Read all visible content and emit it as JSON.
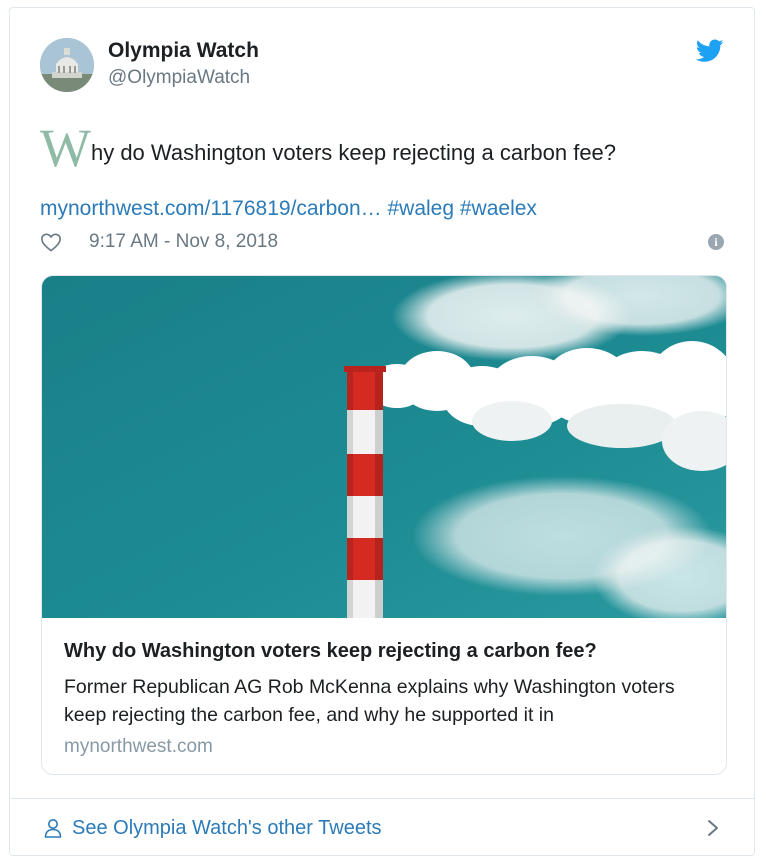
{
  "author": {
    "name": "Olympia Watch",
    "handle": "@OlympiaWatch"
  },
  "tweet": {
    "dropcap": "W",
    "text_rest": "hy do Washington voters keep rejecting a carbon fee?",
    "link": "mynorthwest.com/1176819/carbon…",
    "hashtags": [
      "#waleg",
      "#waelex"
    ],
    "timestamp": "9:17 AM - Nov 8, 2018"
  },
  "card": {
    "title": "Why do Washington voters keep rejecting a carbon fee?",
    "description": "Former Republican AG Rob McKenna explains why Washington voters keep rejecting the carbon fee, and why he supported it in",
    "domain": "mynorthwest.com"
  },
  "footer": {
    "label": "See Olympia Watch's other Tweets"
  },
  "icons": {
    "brand": "twitter-bird-icon",
    "like": "heart-icon",
    "info": "info-icon",
    "profile": "person-icon",
    "more": "chevron-right-icon"
  },
  "colors": {
    "link": "#2b7bb9",
    "twitter_blue": "#1da1f2",
    "muted_text": "#697882",
    "dropcap": "#8fbaa6",
    "sky": "#1d8c93"
  }
}
